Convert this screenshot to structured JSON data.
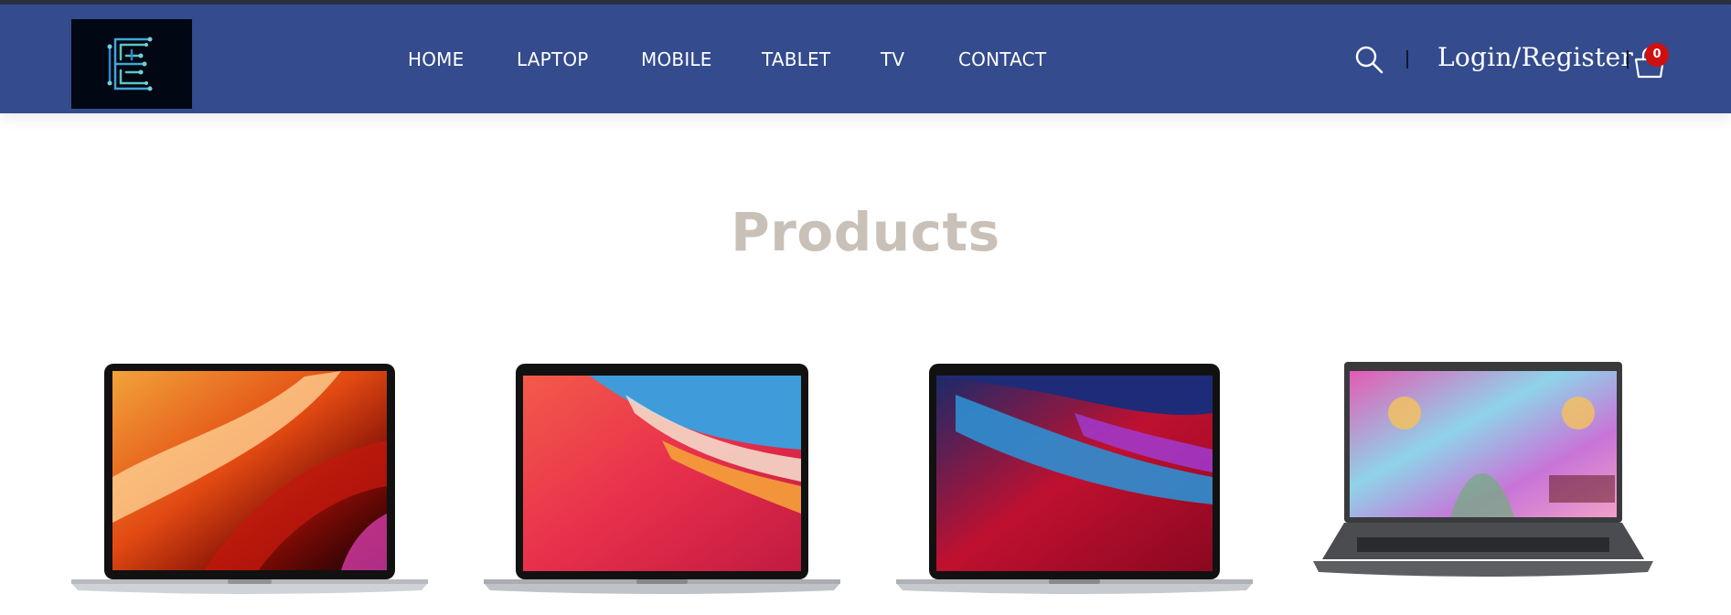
{
  "header": {
    "logo_alt": "E logo",
    "nav": [
      "HOME",
      "LAPTOP",
      "MOBILE",
      "TABLET",
      "TV",
      "CONTACT"
    ],
    "search_icon": "search-icon",
    "login_label": "Login/Register",
    "cart_icon": "shopping-bag-icon",
    "cart_count": "0"
  },
  "products_section": {
    "title": "Products",
    "items": [
      {
        "image": "MacBook Pro laptop"
      },
      {
        "image": "MacBook Air laptop"
      },
      {
        "image": "MacBook Pro M1 laptop"
      },
      {
        "image": "Dell gaming laptop"
      }
    ]
  },
  "colors": {
    "navbar": "#344b8d",
    "title": "#c9c1b8",
    "badge": "#d01010"
  }
}
